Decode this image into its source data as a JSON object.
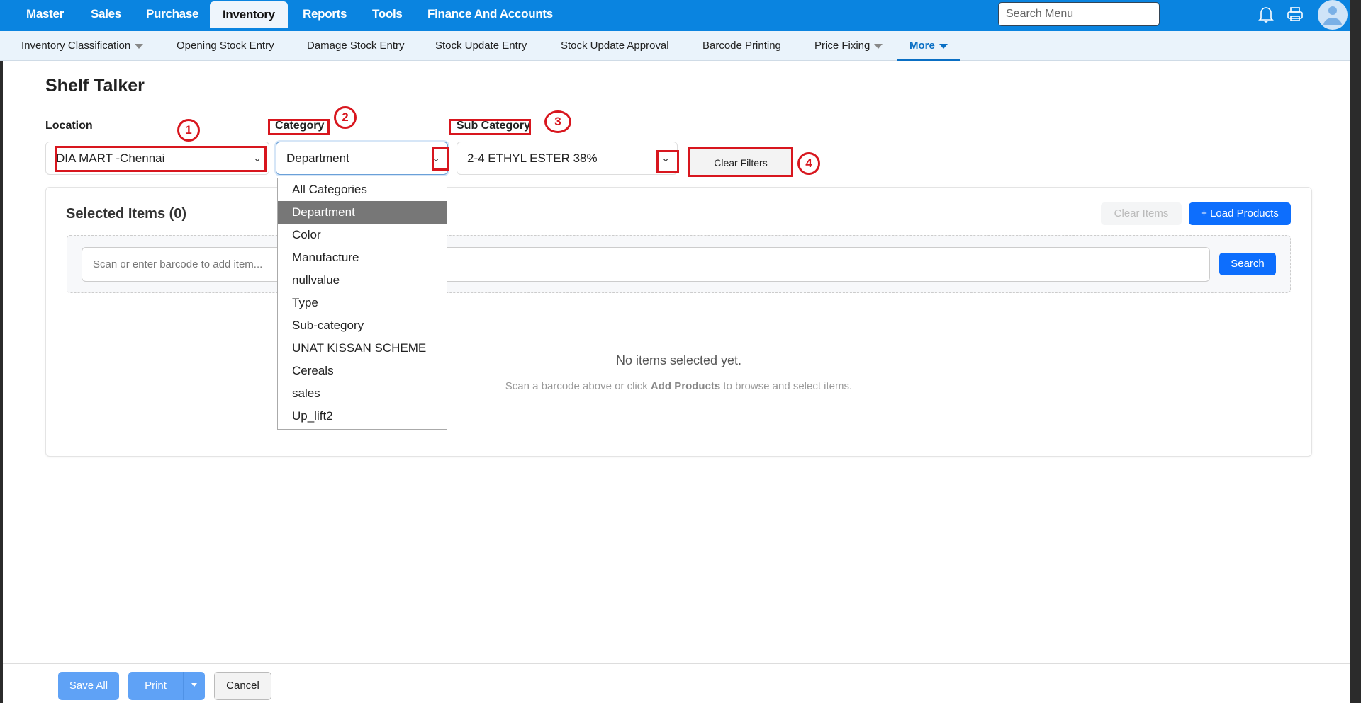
{
  "topnav": {
    "items": [
      "Master",
      "Sales",
      "Purchase",
      "Inventory",
      "Reports",
      "Tools",
      "Finance And Accounts"
    ],
    "search_placeholder": "Search Menu"
  },
  "subnav": {
    "items": [
      "Inventory Classification",
      "Opening Stock Entry",
      "Damage Stock Entry",
      "Stock Update Entry",
      "Stock Update Approval",
      "Barcode Printing",
      "Price Fixing",
      "More"
    ]
  },
  "page": {
    "title": "Shelf Talker"
  },
  "filters": {
    "location_label": "Location",
    "location_value": "DIA MART -Chennai",
    "category_label": "Category",
    "category_value": "Department",
    "subcategory_label": "Sub Category",
    "subcategory_value": "2-4 ETHYL ESTER 38%",
    "clear_filters": "Clear Filters"
  },
  "category_options": [
    "All Categories",
    "Department",
    "Color",
    "Manufacture",
    "nullvalue",
    "Type",
    "Sub-category",
    "UNAT KISSAN SCHEME",
    "Cereals",
    "sales",
    "Up_lift2"
  ],
  "selected": {
    "title": "Selected Items (0)",
    "clear_items": "Clear Items",
    "load_products": "+ Load Products",
    "barcode_placeholder": "Scan or enter barcode to add item...",
    "search": "Search",
    "empty_title": "No items selected yet.",
    "empty_pre": "Scan a barcode above or click ",
    "empty_link": "Add Products",
    "empty_post": " to browse and select items."
  },
  "footer": {
    "save_all": "Save All",
    "print": "Print",
    "cancel": "Cancel"
  },
  "annotations": [
    "1",
    "2",
    "3",
    "4"
  ],
  "colors": {
    "brand": "#0a84e0",
    "primary": "#0d6efd",
    "annotation": "#d8161e"
  }
}
